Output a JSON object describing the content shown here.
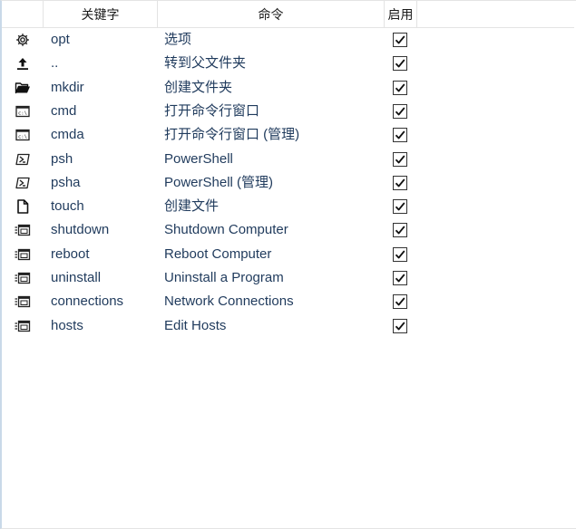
{
  "columns": {
    "icon": "",
    "keyword": "关键字",
    "command": "命令",
    "enabled": "启用"
  },
  "rows": [
    {
      "icon": "gear-icon",
      "keyword": "opt",
      "command": "选项",
      "enabled": true
    },
    {
      "icon": "upload-arrow-icon",
      "keyword": "..",
      "command": "转到父文件夹",
      "enabled": true
    },
    {
      "icon": "folder-open-icon",
      "keyword": "mkdir",
      "command": "创建文件夹",
      "enabled": true
    },
    {
      "icon": "cmd-console-icon",
      "keyword": "cmd",
      "command": "打开命令行窗口",
      "enabled": true
    },
    {
      "icon": "cmd-console-icon",
      "keyword": "cmda",
      "command": "打开命令行窗口 (管理)",
      "enabled": true
    },
    {
      "icon": "powershell-icon",
      "keyword": "psh",
      "command": "PowerShell",
      "enabled": true
    },
    {
      "icon": "powershell-icon",
      "keyword": "psha",
      "command": "PowerShell (管理)",
      "enabled": true
    },
    {
      "icon": "file-icon",
      "keyword": "touch",
      "command": "创建文件",
      "enabled": true
    },
    {
      "icon": "system-window-icon",
      "keyword": "shutdown",
      "command": "Shutdown Computer",
      "enabled": true
    },
    {
      "icon": "system-window-icon",
      "keyword": "reboot",
      "command": "Reboot Computer",
      "enabled": true
    },
    {
      "icon": "system-window-icon",
      "keyword": "uninstall",
      "command": "Uninstall a Program",
      "enabled": true
    },
    {
      "icon": "system-window-icon",
      "keyword": "connections",
      "command": "Network Connections",
      "enabled": true
    },
    {
      "icon": "system-window-icon",
      "keyword": "hosts",
      "command": "Edit Hosts",
      "enabled": true
    }
  ]
}
